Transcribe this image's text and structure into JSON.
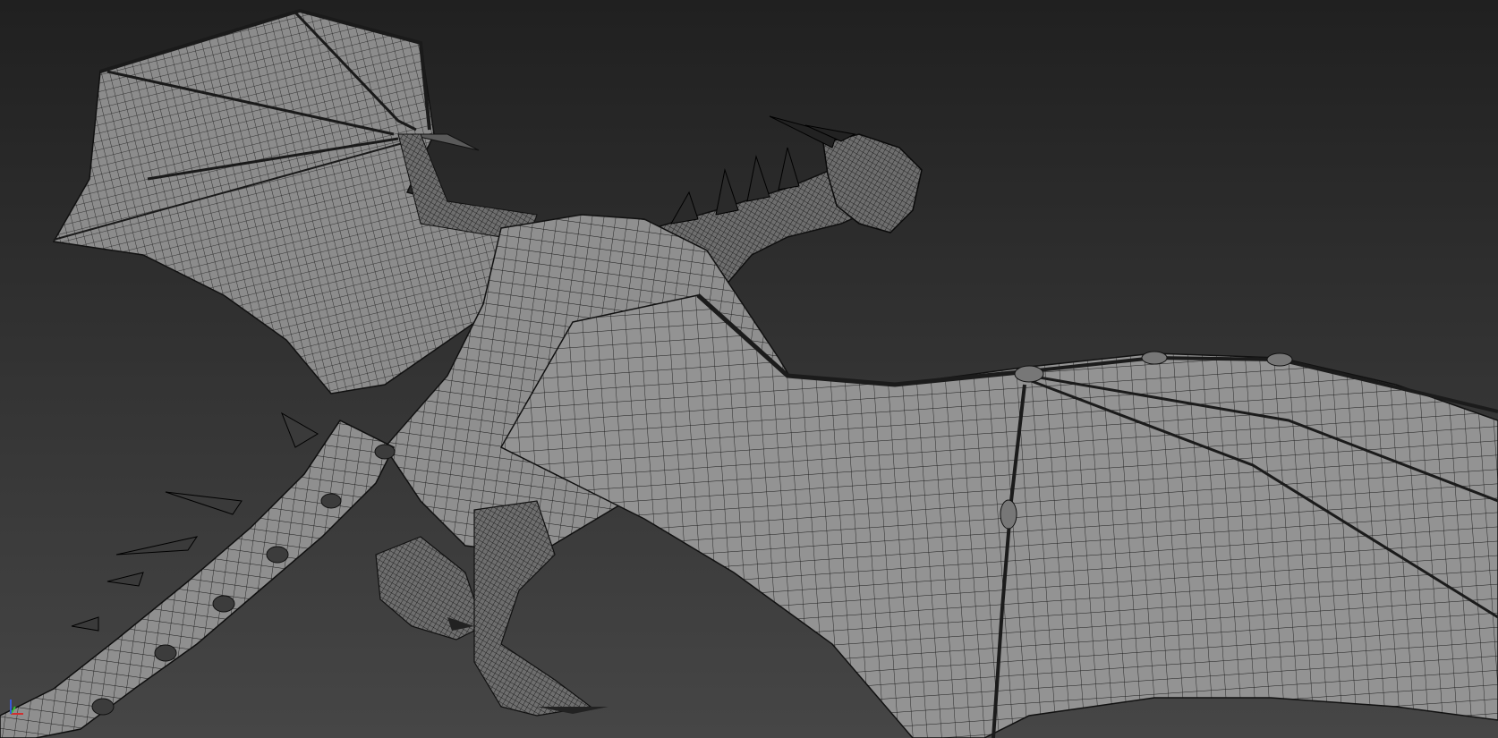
{
  "viewport": {
    "background_top": "#202020",
    "background_bottom": "#454545",
    "mesh_fill": "#8e8e8e",
    "mesh_fill_dark": "#6f6f6f",
    "wire_color": "#141414"
  },
  "gizmo": {
    "x_color": "#d03030",
    "y_color": "#30c030",
    "z_color": "#3a5ad8"
  },
  "icons": {
    "model": "dragon-wireframe-mesh",
    "gizmo": "axis-gizmo-icon"
  }
}
